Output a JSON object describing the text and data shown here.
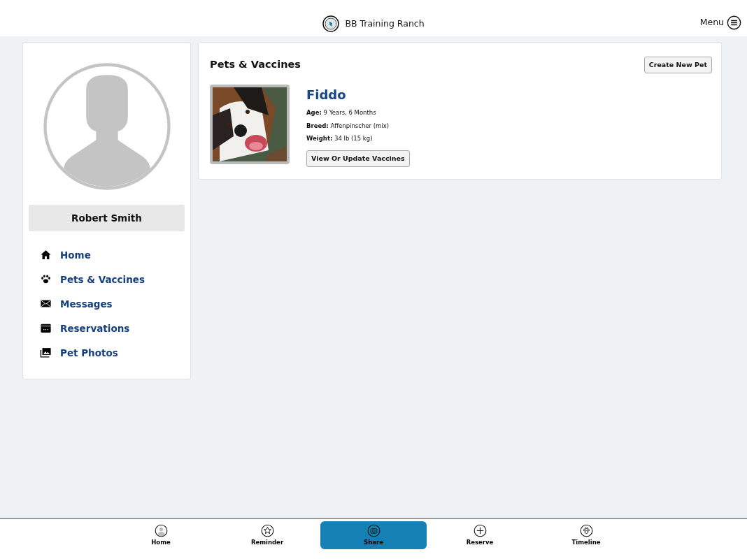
{
  "header": {
    "title": "BB Training Ranch",
    "menu_label": "Menu"
  },
  "profile": {
    "name": "Robert Smith"
  },
  "sidebar": {
    "items": [
      {
        "label": "Home"
      },
      {
        "label": "Pets & Vaccines"
      },
      {
        "label": "Messages"
      },
      {
        "label": "Reservations"
      },
      {
        "label": "Pet Photos"
      }
    ]
  },
  "main": {
    "title": "Pets & Vaccines",
    "create_button": "Create New Pet",
    "pets": [
      {
        "name": "Fiddo",
        "facts": [
          "**Age:** 9 Years, 6 Months",
          "**Breed:** Affenpinscher (mix)",
          "**Weight:** 34 lb (15 kg)"
        ],
        "button": "View Or Update Vaccines"
      }
    ]
  },
  "tab_bar": [
    {
      "label": "Home",
      "selected": false
    },
    {
      "label": "Reminder",
      "selected": false
    },
    {
      "label": "Share",
      "selected": true
    },
    {
      "label": "Reserve",
      "selected": false
    },
    {
      "label": "Timeline",
      "selected": false
    }
  ]
}
